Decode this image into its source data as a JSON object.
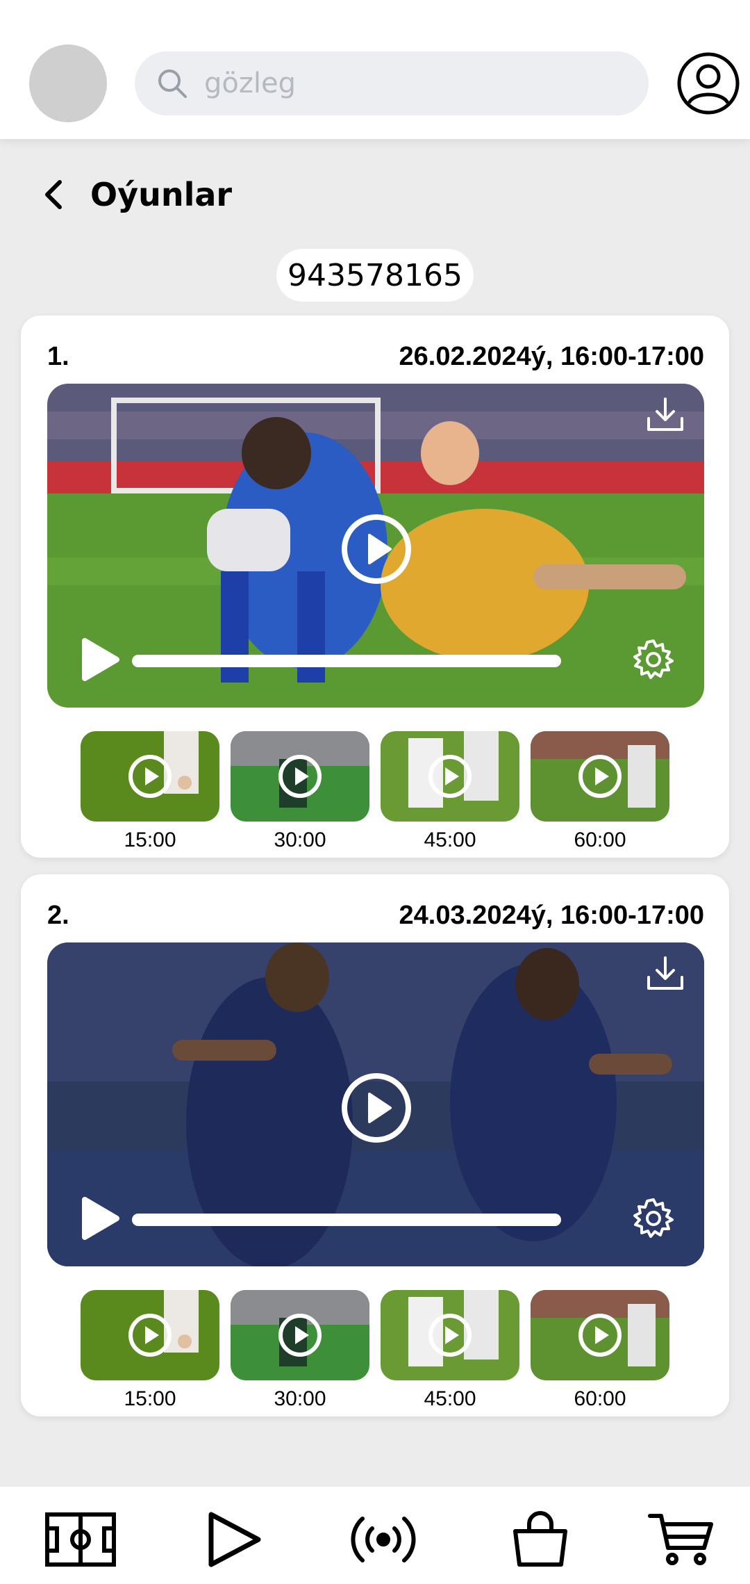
{
  "header": {
    "search_placeholder": "gözleg",
    "icons": {
      "search": "search-icon",
      "profile": "user-circle-icon"
    }
  },
  "page": {
    "title": "Oýunlar",
    "back_icon": "chevron-left-icon",
    "id_value": "943578165"
  },
  "games": [
    {
      "index": "1.",
      "datetime": "26.02.2024ý, 16:00-17:00",
      "thumbnails": [
        {
          "time": "15:00"
        },
        {
          "time": "30:00"
        },
        {
          "time": "45:00"
        },
        {
          "time": "60:00"
        }
      ]
    },
    {
      "index": "2.",
      "datetime": "24.03.2024ý, 16:00-17:00",
      "thumbnails": [
        {
          "time": "15:00"
        },
        {
          "time": "30:00"
        },
        {
          "time": "45:00"
        },
        {
          "time": "60:00"
        }
      ]
    }
  ],
  "bottom_nav": [
    {
      "icon": "football-field-icon"
    },
    {
      "icon": "play-icon"
    },
    {
      "icon": "broadcast-icon"
    },
    {
      "icon": "shopping-bag-icon"
    },
    {
      "icon": "shopping-cart-icon"
    }
  ],
  "colors": {
    "background": "#ececec",
    "surface": "#ffffff",
    "pitch_green": "#4e8f2e",
    "blue_kit": "#1f4fb8",
    "navy_kit": "#1e2a5a"
  }
}
